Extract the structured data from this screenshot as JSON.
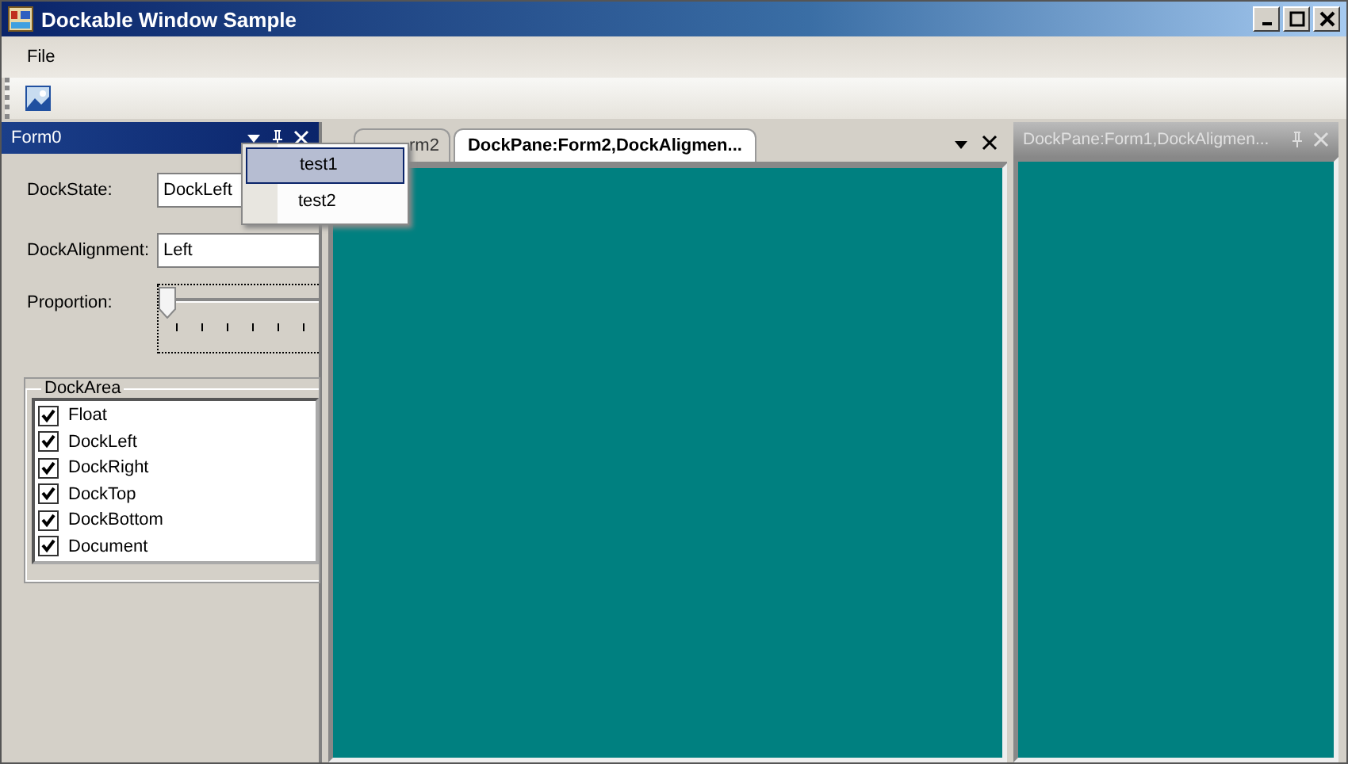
{
  "window": {
    "title": "Dockable Window Sample"
  },
  "menu": [
    "File"
  ],
  "left_pane": {
    "title": "Form0",
    "fields": [
      {
        "label": "DockState:",
        "value": "DockLeft"
      },
      {
        "label": "DockAlignment:",
        "value": "Left"
      }
    ],
    "proportion": {
      "label": "Proportion:",
      "level": 0
    },
    "dock_area": {
      "title": "DockArea",
      "items": [
        {
          "label": "Float",
          "checked": true
        },
        {
          "label": "DockLeft",
          "checked": true
        },
        {
          "label": "DockRight",
          "checked": true
        },
        {
          "label": "DockTop",
          "checked": true
        },
        {
          "label": "DockBottom",
          "checked": true
        },
        {
          "label": "Document",
          "checked": true
        }
      ]
    }
  },
  "document": {
    "tabs": [
      {
        "label": "rm2",
        "selected": false
      },
      {
        "label": "DockPane:Form2,DockAligmen...",
        "selected": true
      }
    ]
  },
  "right_pane": {
    "title": "DockPane:Form1,DockAligmen..."
  },
  "context_menu": [
    {
      "label": "test1",
      "selected": true
    },
    {
      "label": "test2",
      "selected": false
    }
  ]
}
